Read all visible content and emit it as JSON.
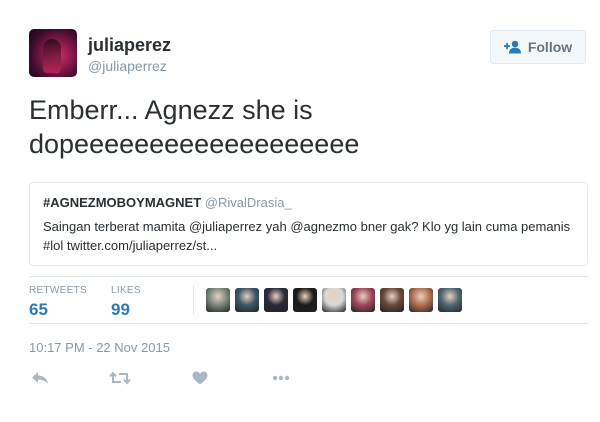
{
  "user": {
    "display_name": "juliaperez",
    "handle": "@juliaperrez"
  },
  "follow_button": {
    "label": "Follow"
  },
  "tweet": {
    "text": "Emberr... Agnezz she is\ndopeeeeeeeeeeeeeeeeeee"
  },
  "quote": {
    "hashtag": "#AGNEZMOBOYMAGNET",
    "handle": "@RivalDrasia_",
    "text": "Saingan terberat mamita @juliaperrez yah @agnezmo bner gak? Klo yg lain cuma pemanis #lol twitter.com/juliaperrez/st..."
  },
  "stats": {
    "retweets_label": "RETWEETS",
    "retweets_value": "65",
    "likes_label": "LIKES",
    "likes_value": "99"
  },
  "likers_colors": [
    "#7a8a7a",
    "#3c5868",
    "#2a2a3a",
    "#1a1a1a",
    "#d8d8d8",
    "#a0485a",
    "#6a4a3a",
    "#b07050",
    "#506870"
  ],
  "timestamp": "10:17 PM - 22 Nov 2015",
  "action_icons": [
    "reply-icon",
    "retweet-icon",
    "like-icon",
    "more-icon"
  ],
  "colors": {
    "link": "#2b7bb9",
    "muted": "#8899a6",
    "text": "#292f33",
    "border": "#e1e8ed",
    "icon": "#aab8c2"
  }
}
